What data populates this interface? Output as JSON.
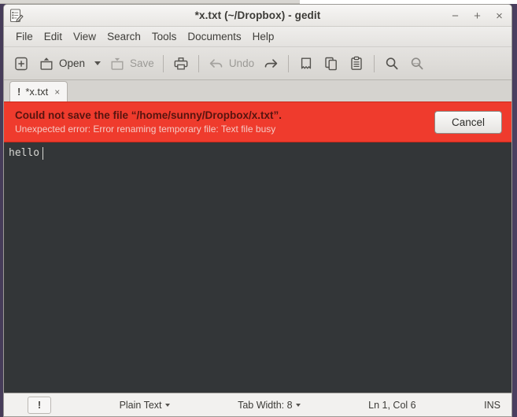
{
  "window": {
    "title": "*x.txt (~/Dropbox) - gedit",
    "app_icon": "gedit-document-icon",
    "controls": [
      {
        "name": "minimize",
        "glyph": "−"
      },
      {
        "name": "maximize",
        "glyph": "+"
      },
      {
        "name": "close",
        "glyph": "×"
      }
    ]
  },
  "menubar": {
    "items": [
      {
        "label": "File"
      },
      {
        "label": "Edit"
      },
      {
        "label": "View"
      },
      {
        "label": "Search"
      },
      {
        "label": "Tools"
      },
      {
        "label": "Documents"
      },
      {
        "label": "Help"
      }
    ]
  },
  "toolbar": {
    "new_label": "",
    "open_label": "Open",
    "save_label": "Save",
    "print_label": "",
    "undo_label": "Undo",
    "redo_label": "",
    "icons": {
      "new": "new-document-icon",
      "open": "open-folder-icon",
      "open_dropdown": "chevron-down-icon",
      "save": "save-icon",
      "print": "print-icon",
      "undo": "undo-arrow-icon",
      "redo": "redo-arrow-icon",
      "cut": "cut-icon",
      "copy": "copy-icon",
      "paste": "paste-icon",
      "find": "search-icon",
      "replace": "find-replace-icon"
    }
  },
  "tab": {
    "warning_glyph": "!",
    "label": "*x.txt",
    "close_glyph": "×"
  },
  "infobar": {
    "title": "Could not save the file “/home/sunny/Dropbox/x.txt”.",
    "message": "Unexpected error: Error renaming temporary file: Text file busy",
    "cancel_label": "Cancel",
    "background_color": "#ef3b2d",
    "title_color": "#57140f",
    "message_color": "#f4c9c4"
  },
  "editor": {
    "content": "hello",
    "background_color": "#333638",
    "text_color": "#d8d8d4"
  },
  "statusbar": {
    "warning_glyph": "!",
    "language": "Plain Text",
    "tab_width": "Tab Width: 8",
    "position": "Ln 1, Col 6",
    "insert_mode": "INS"
  }
}
